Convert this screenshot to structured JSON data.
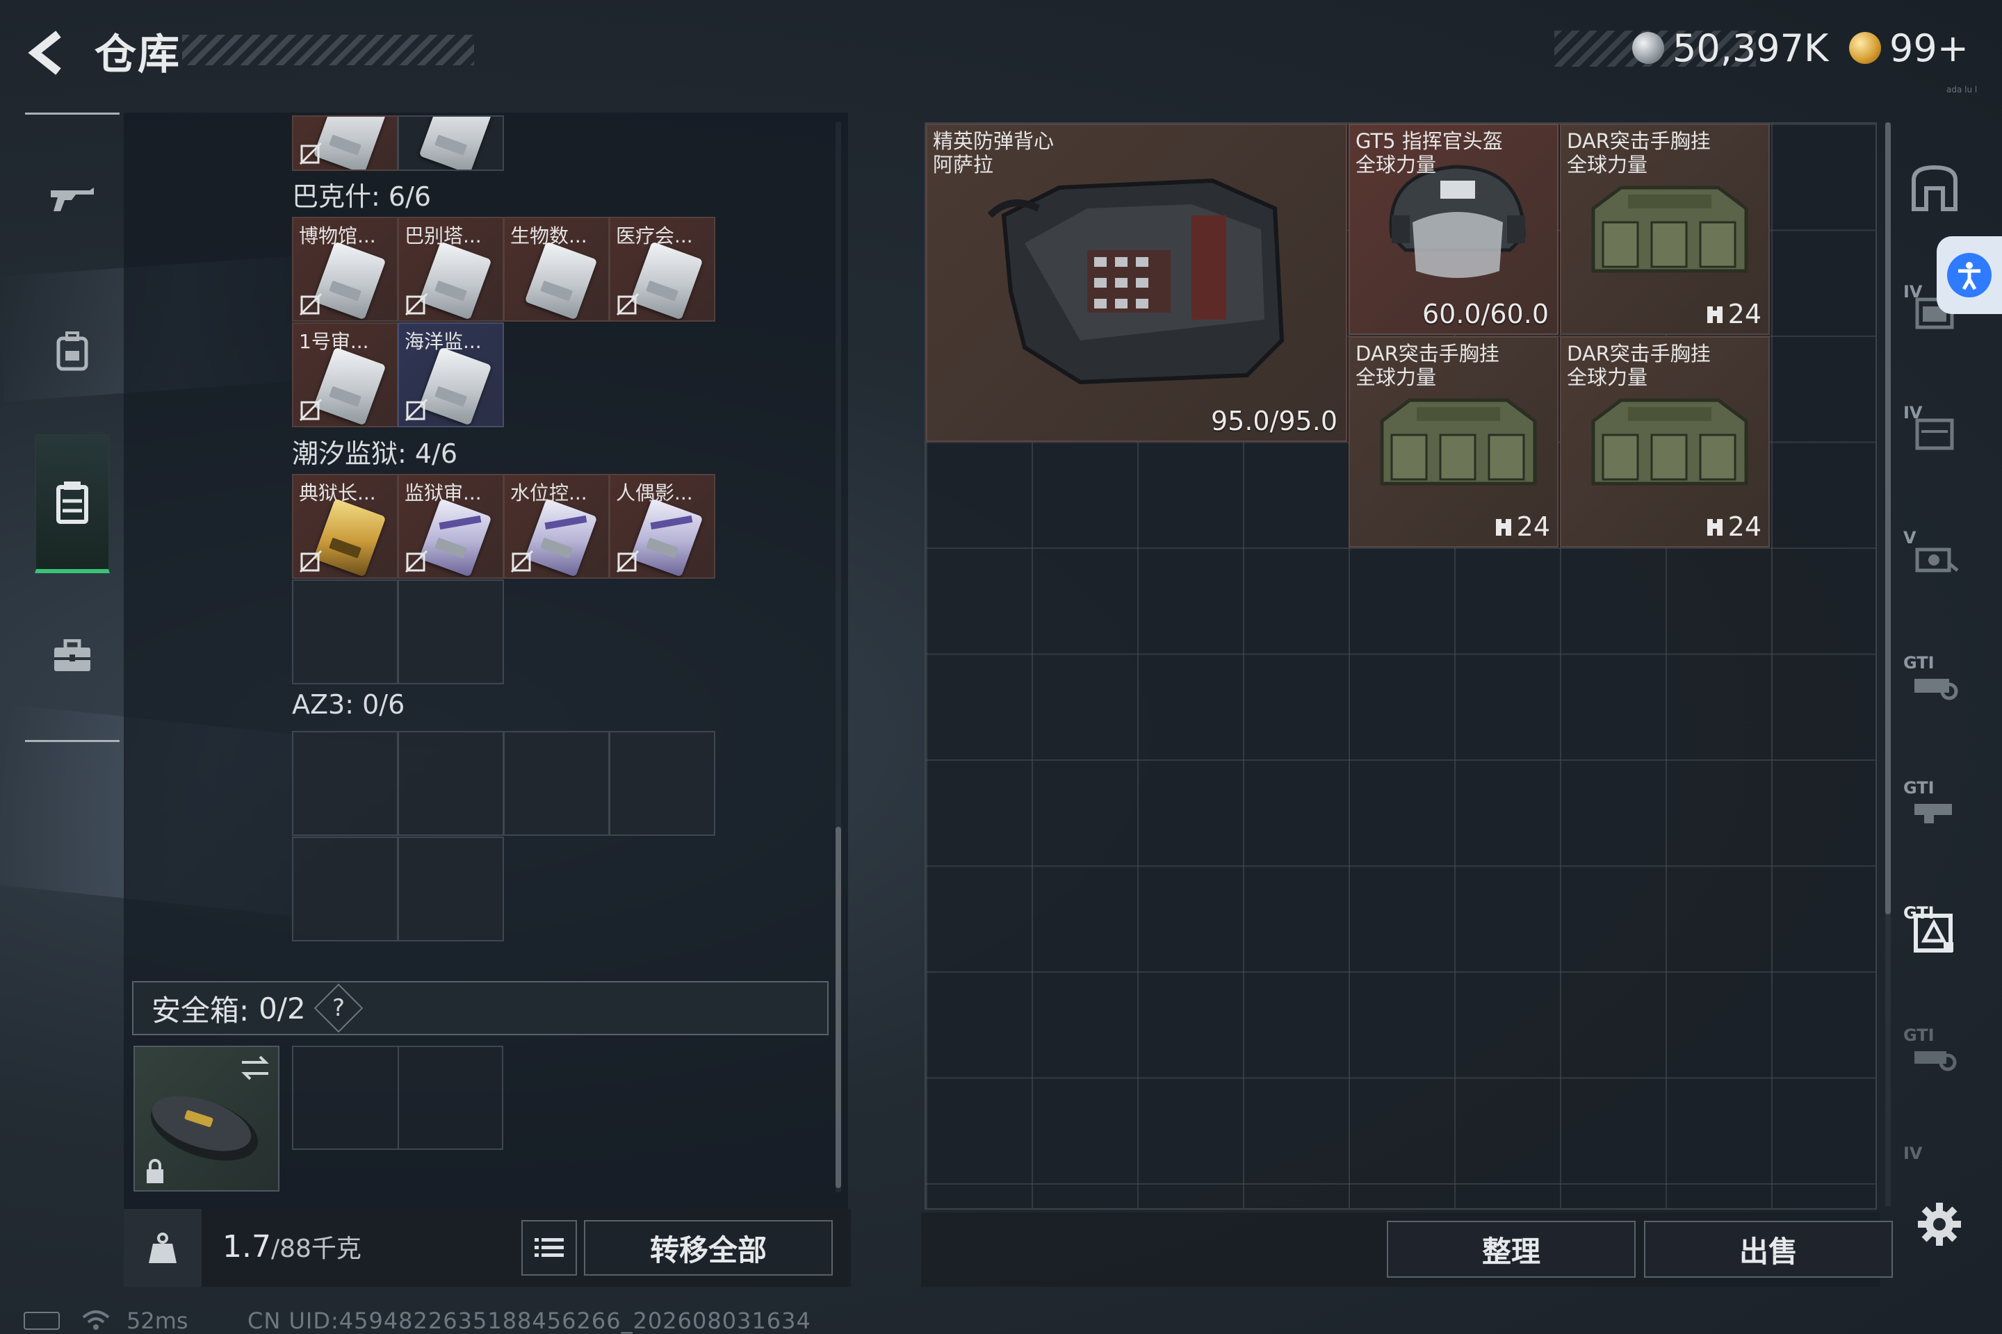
{
  "header": {
    "title": "仓库",
    "currency_silver": "50,397K",
    "currency_gold": "99+",
    "version": "ada lu l"
  },
  "left_nav": {
    "items": [
      {
        "name": "weapon-tab",
        "icon": "rifle-icon"
      },
      {
        "name": "backpack-tab",
        "icon": "backpack-icon"
      },
      {
        "name": "vest-tab",
        "icon": "vest-icon",
        "active": true
      },
      {
        "name": "case-tab",
        "icon": "briefcase-icon"
      }
    ],
    "active_color": "#39c27a"
  },
  "container": {
    "sections": [
      {
        "label": "巴克什: 6/6",
        "slots": [
          "博物馆...",
          "巴别塔...",
          "生物数...",
          "医疗会...",
          "1号审...",
          "海洋监..."
        ]
      },
      {
        "label": "潮汐监狱: 4/6",
        "slots": [
          "典狱长...",
          "监狱审...",
          "水位控...",
          "人偶影..."
        ]
      },
      {
        "label": "AZ3: 0/6",
        "slots": []
      }
    ],
    "safe_box": {
      "label": "安全箱:",
      "count": "0/2",
      "help": "?"
    }
  },
  "bottom_left": {
    "weight_current": "1.7",
    "weight_max": "/88千克",
    "transfer_all": "转移全部"
  },
  "stash": {
    "items": [
      {
        "name": "精英防弹背心\n阿萨拉",
        "value": "95.0/95.0"
      },
      {
        "name": "GT5 指挥官头盔\n全球力量",
        "value": "60.0/60.0"
      },
      {
        "name": "DAR突击手胸挂\n全球力量",
        "value": "24"
      },
      {
        "name": "DAR突击手胸挂\n全球力量",
        "value": "24"
      },
      {
        "name": "DAR突击手胸挂\n全球力量",
        "value": "24"
      }
    ]
  },
  "bottom_right": {
    "sort": "整理",
    "sell": "出售"
  },
  "right_sidebar": {
    "items": [
      {
        "label": "",
        "icon": "vest-slot-icon"
      },
      {
        "label": "IV",
        "icon": "armor-iv-icon"
      },
      {
        "label": "IV",
        "icon": "armor-iv-2-icon"
      },
      {
        "label": "V",
        "icon": "armor-v-icon"
      },
      {
        "label": "GTI",
        "icon": "gti-vehicle-icon"
      },
      {
        "label": "GTI",
        "icon": "gti-vehicle-2-icon"
      },
      {
        "label": "GTI",
        "icon": "gti-selected-icon"
      },
      {
        "label": "GTI",
        "icon": "gti-vehicle-3-icon"
      },
      {
        "label": "IV",
        "icon": "armor-iv-3-icon"
      }
    ]
  },
  "status_bar": {
    "ping": "52ms",
    "uid": "CN UID:4594822635188456266_202608031634"
  }
}
